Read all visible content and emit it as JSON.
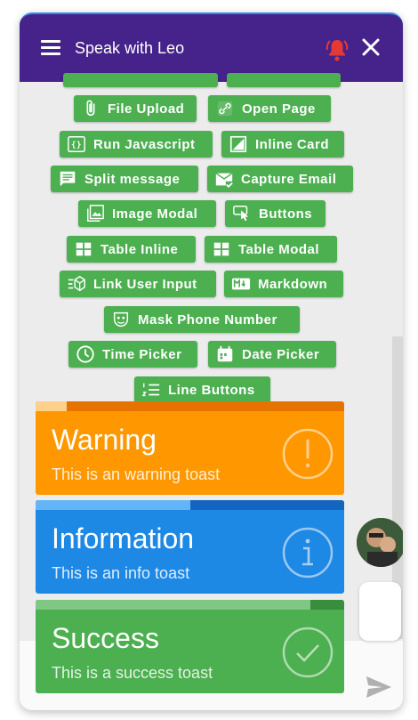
{
  "header": {
    "title": "Speak with Leo"
  },
  "chips": [
    {
      "label": "File Upload",
      "icon": "paperclip-icon"
    },
    {
      "label": "Open Page",
      "icon": "link-icon"
    },
    {
      "label": "Run Javascript",
      "icon": "code-braces-icon"
    },
    {
      "label": "Inline Card",
      "icon": "inline-card-icon"
    },
    {
      "label": "Split message",
      "icon": "message-icon"
    },
    {
      "label": "Capture Email",
      "icon": "email-check-icon"
    },
    {
      "label": "Image Modal",
      "icon": "image-icon"
    },
    {
      "label": "Buttons",
      "icon": "touch-button-icon"
    },
    {
      "label": "Table Inline",
      "icon": "table-icon"
    },
    {
      "label": "Table Modal",
      "icon": "table-icon"
    },
    {
      "label": "Link User Input",
      "icon": "link-input-icon"
    },
    {
      "label": "Markdown",
      "icon": "markdown-icon"
    },
    {
      "label": "Mask Phone Number",
      "icon": "mask-icon"
    },
    {
      "label": "Time Picker",
      "icon": "clock-icon"
    },
    {
      "label": "Date Picker",
      "icon": "calendar-icon"
    },
    {
      "label": "Line Buttons",
      "icon": "list-numbered-icon"
    }
  ],
  "toasts": {
    "warning": {
      "title": "Warning",
      "message": "This is an warning toast",
      "color": "#ff9800",
      "bar_color": "#e67300",
      "bar_light": "#ffd08a",
      "progress": 0.1
    },
    "info": {
      "title": "Information",
      "message": "This is an info toast",
      "color": "#1e88e5",
      "bar_color": "#1565c0",
      "bar_light": "#64b5f6",
      "progress": 0.5
    },
    "success": {
      "title": "Success",
      "message": "This is a success toast",
      "color": "#4caf50",
      "bar_color": "#388e3c",
      "bar_light": "#81c784",
      "progress": 0.9
    }
  },
  "colors": {
    "header": "#45238a",
    "chip": "#4caf50",
    "bell": "#e53935"
  }
}
